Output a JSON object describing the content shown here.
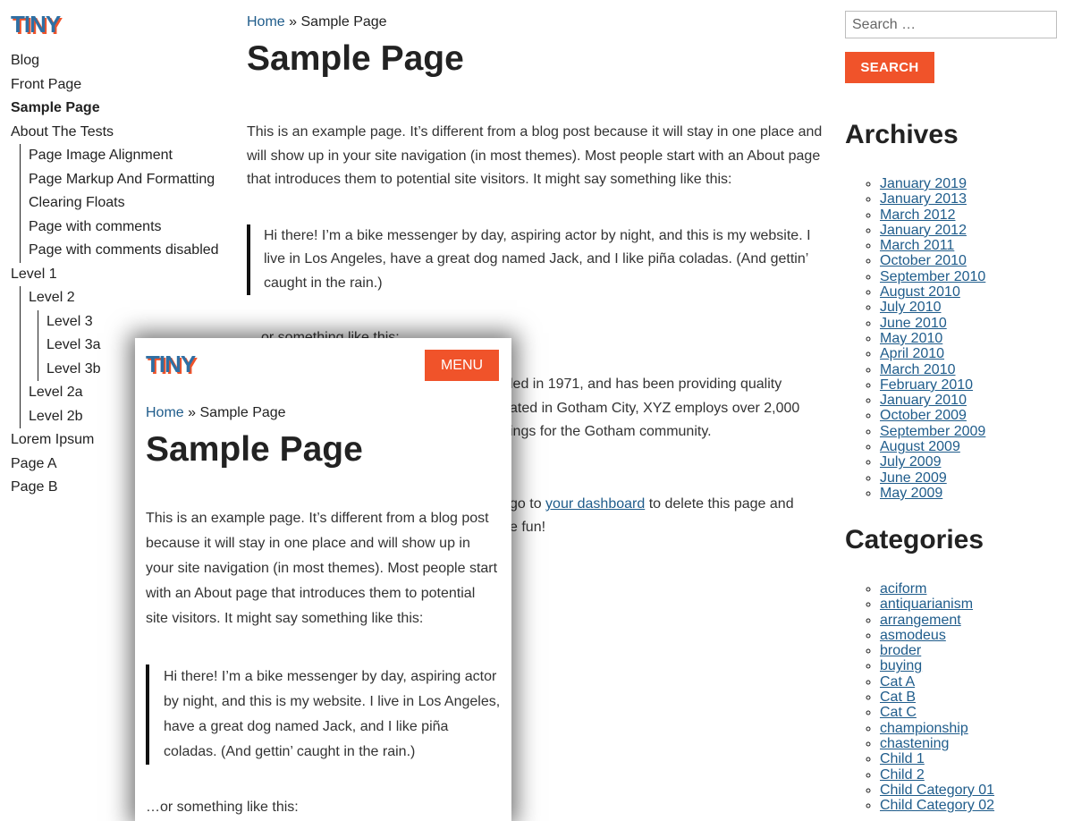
{
  "site": {
    "logo": "TINY"
  },
  "nav": {
    "blog": "Blog",
    "front_page": "Front Page",
    "sample_page": "Sample Page",
    "about_tests": "About The Tests",
    "about_children": [
      "Page Image Alignment",
      "Page Markup And Formatting",
      "Clearing Floats",
      "Page with comments",
      "Page with comments disabled"
    ],
    "level1": "Level 1",
    "level2": "Level 2",
    "level3": "Level 3",
    "level3a": "Level 3a",
    "level3b": "Level 3b",
    "level2a": "Level 2a",
    "level2b": "Level 2b",
    "lorem": "Lorem Ipsum",
    "page_a": "Page A",
    "page_b": "Page B"
  },
  "breadcrumb": {
    "home": "Home",
    "separator": "»",
    "current": "Sample Page"
  },
  "page": {
    "title": "Sample Page",
    "intro": "This is an example page. It’s different from a blog post because it will stay in one place and will show up in your site navigation (in most themes). Most people start with an About page that introduces them to potential site visitors. It might say something like this:",
    "quote1": "Hi there! I’m a bike messenger by day, aspiring actor by night, and this is my website. I live in Los Angeles, have a great dog named Jack, and I like piña coladas. (And gettin’ caught in the rain.)",
    "or_something": "…or something like this:",
    "quote2_line1": "led in 1971, and has been providing quality",
    "quote2_line2": "ated in Gotham City, XYZ employs over 2,000",
    "quote2_line3": "ings for the Gotham community.",
    "outro_before": "go to",
    "dashboard_link": "your dashboard",
    "outro_after": "to delete this page and",
    "outro_line2": "e fun!"
  },
  "search": {
    "placeholder": "Search …",
    "button": "SEARCH"
  },
  "archives": {
    "title": "Archives",
    "items": [
      "January 2019",
      "January 2013",
      "March 2012",
      "January 2012",
      "March 2011",
      "October 2010",
      "September 2010",
      "August 2010",
      "July 2010",
      "June 2010",
      "May 2010",
      "April 2010",
      "March 2010",
      "February 2010",
      "January 2010",
      "October 2009",
      "September 2009",
      "August 2009",
      "July 2009",
      "June 2009",
      "May 2009"
    ]
  },
  "categories": {
    "title": "Categories",
    "items": [
      "aciform",
      "antiquarianism",
      "arrangement",
      "asmodeus",
      "broder",
      "buying",
      "Cat A",
      "Cat B",
      "Cat C",
      "championship",
      "chastening",
      "Child 1",
      "Child 2",
      "Child Category 01",
      "Child Category 02"
    ]
  },
  "mobile": {
    "logo": "TINY",
    "menu": "MENU",
    "peek_text": "…or something like this:"
  },
  "colors": {
    "accent": "#f0532a",
    "link": "#1f5c8b",
    "logo": "#2f6fa3"
  }
}
